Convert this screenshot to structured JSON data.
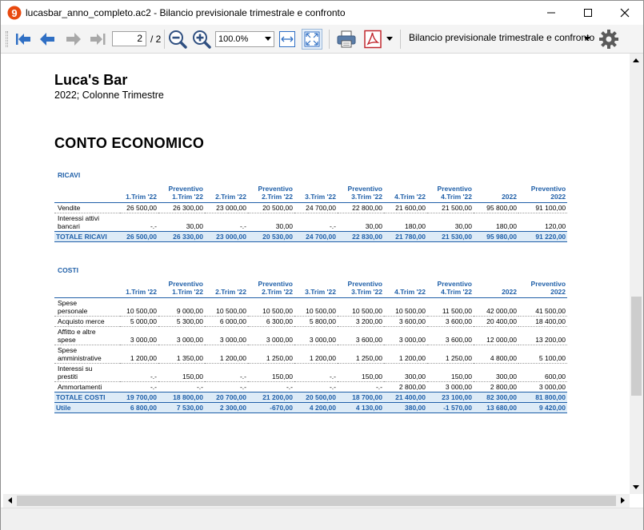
{
  "window": {
    "title": "lucasbar_anno_completo.ac2 - Bilancio previsionale trimestrale e confronto",
    "app_icon_glyph": "9",
    "accent": "#e8490f"
  },
  "toolbar": {
    "page_current": "2",
    "page_total": "/ 2",
    "zoom": "100.0%",
    "report_name": "Bilancio previsionale trimestrale e confronto"
  },
  "report": {
    "company": "Luca's Bar",
    "subtitle": "2022; Colonne Trimestre",
    "section_title": "CONTO ECONOMICO",
    "header_color": "#1f5fa8",
    "total_bg": "#ddebf7",
    "columns": [
      [
        "1.Trim '22"
      ],
      [
        "Preventivo",
        "1.Trim '22"
      ],
      [
        "2.Trim '22"
      ],
      [
        "Preventivo",
        "2.Trim '22"
      ],
      [
        "3.Trim '22"
      ],
      [
        "Preventivo",
        "3.Trim '22"
      ],
      [
        "4.Trim '22"
      ],
      [
        "Preventivo",
        "4.Trim '22"
      ],
      [
        "2022"
      ],
      [
        "Preventivo",
        "2022"
      ]
    ],
    "ricavi": {
      "caption": "RICAVI",
      "rows": [
        {
          "label": [
            "Vendite"
          ],
          "values": [
            "26 500,00",
            "26 300,00",
            "23 000,00",
            "20 500,00",
            "24 700,00",
            "22 800,00",
            "21 600,00",
            "21 500,00",
            "95 800,00",
            "91 100,00"
          ]
        },
        {
          "label": [
            "Interessi attivi",
            "bancari"
          ],
          "values": [
            "-.-",
            "30,00",
            "-.-",
            "30,00",
            "-.-",
            "30,00",
            "180,00",
            "30,00",
            "180,00",
            "120,00"
          ]
        }
      ],
      "total": {
        "label": "TOTALE RICAVI",
        "values": [
          "26 500,00",
          "26 330,00",
          "23 000,00",
          "20 530,00",
          "24 700,00",
          "22 830,00",
          "21 780,00",
          "21 530,00",
          "95 980,00",
          "91 220,00"
        ]
      }
    },
    "costi": {
      "caption": "COSTI",
      "rows": [
        {
          "label": [
            "Spese",
            "personale"
          ],
          "values": [
            "10 500,00",
            "9 000,00",
            "10 500,00",
            "10 500,00",
            "10 500,00",
            "10 500,00",
            "10 500,00",
            "11 500,00",
            "42 000,00",
            "41 500,00"
          ]
        },
        {
          "label": [
            "Acquisto merce"
          ],
          "values": [
            "5 000,00",
            "5 300,00",
            "6 000,00",
            "6 300,00",
            "5 800,00",
            "3 200,00",
            "3 600,00",
            "3 600,00",
            "20 400,00",
            "18 400,00"
          ]
        },
        {
          "label": [
            "Affitto e altre",
            "spese"
          ],
          "values": [
            "3 000,00",
            "3 000,00",
            "3 000,00",
            "3 000,00",
            "3 000,00",
            "3 600,00",
            "3 000,00",
            "3 600,00",
            "12 000,00",
            "13 200,00"
          ]
        },
        {
          "label": [
            "Spese",
            "amministrative"
          ],
          "values": [
            "1 200,00",
            "1 350,00",
            "1 200,00",
            "1 250,00",
            "1 200,00",
            "1 250,00",
            "1 200,00",
            "1 250,00",
            "4 800,00",
            "5 100,00"
          ]
        },
        {
          "label": [
            "Interessi su",
            "prestiti"
          ],
          "values": [
            "-.-",
            "150,00",
            "-.-",
            "150,00",
            "-.-",
            "150,00",
            "300,00",
            "150,00",
            "300,00",
            "600,00"
          ]
        },
        {
          "label": [
            "Ammortamenti"
          ],
          "values": [
            "-.-",
            "-.-",
            "-.-",
            "-.-",
            "-.-",
            "-.-",
            "2 800,00",
            "3 000,00",
            "2 800,00",
            "3 000,00"
          ]
        }
      ],
      "total": {
        "label": "TOTALE COSTI",
        "values": [
          "19 700,00",
          "18 800,00",
          "20 700,00",
          "21 200,00",
          "20 500,00",
          "18 700,00",
          "21 400,00",
          "23 100,00",
          "82 300,00",
          "81 800,00"
        ]
      }
    },
    "utile": {
      "label": "Utile",
      "values": [
        "6 800,00",
        "7 530,00",
        "2 300,00",
        "-670,00",
        "4 200,00",
        "4 130,00",
        "380,00",
        "-1 570,00",
        "13 680,00",
        "9 420,00"
      ]
    }
  }
}
